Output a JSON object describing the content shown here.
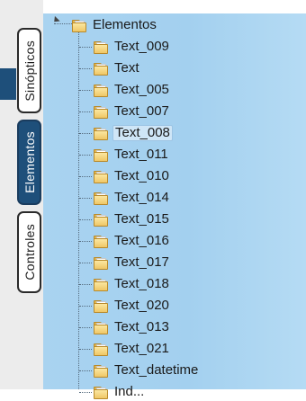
{
  "sidebar": {
    "tabs": [
      {
        "label": "Sinópticos",
        "active": false
      },
      {
        "label": "Elementos",
        "active": true
      },
      {
        "label": "Controles",
        "active": false
      }
    ]
  },
  "tree": {
    "root_label": "Elementos",
    "items": [
      {
        "label": "Text_009"
      },
      {
        "label": "Text"
      },
      {
        "label": "Text_005"
      },
      {
        "label": "Text_007"
      },
      {
        "label": "Text_008",
        "selected": true
      },
      {
        "label": "Text_011"
      },
      {
        "label": "Text_010"
      },
      {
        "label": "Text_014"
      },
      {
        "label": "Text_015"
      },
      {
        "label": "Text_016"
      },
      {
        "label": "Text_017"
      },
      {
        "label": "Text_018"
      },
      {
        "label": "Text_020"
      },
      {
        "label": "Text_013"
      },
      {
        "label": "Text_021"
      },
      {
        "label": "Text_datetime"
      },
      {
        "label": "Ind..."
      }
    ]
  },
  "colors": {
    "accent": "#1e4f7a",
    "panel": "#a9d3f0",
    "selection": "#cfe6f7"
  },
  "icons": {
    "node_icon": "folder-icon",
    "expander": "collapse-arrow-icon"
  }
}
